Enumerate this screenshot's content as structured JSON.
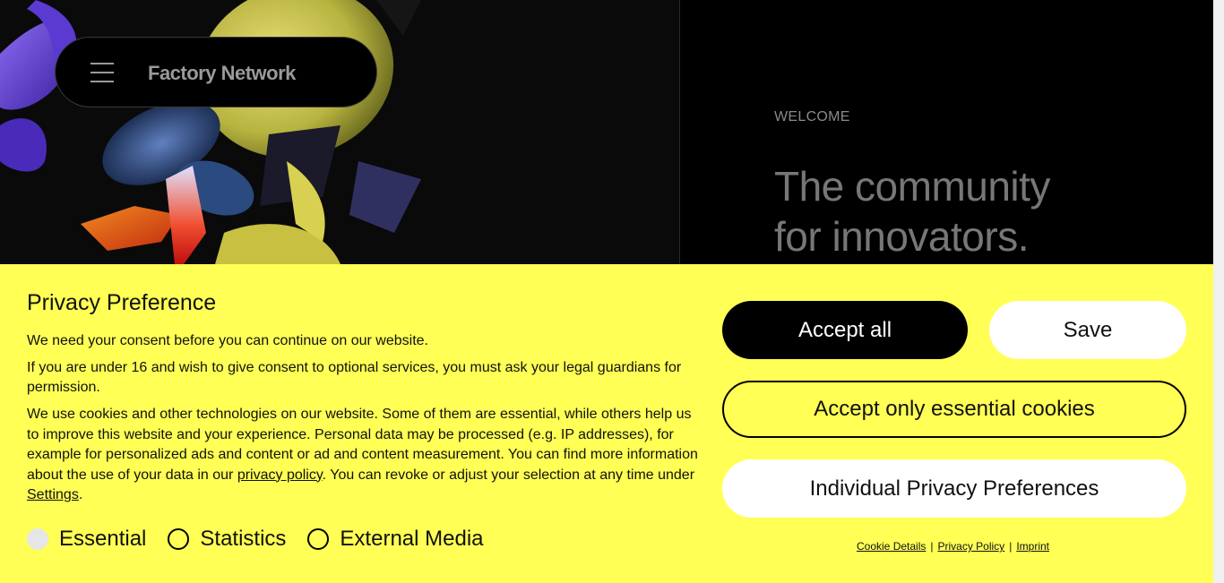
{
  "nav": {
    "brand": "Factory Network"
  },
  "hero": {
    "eyebrow": "WELCOME",
    "headline_line1": "The community",
    "headline_line2": "for innovators."
  },
  "consent": {
    "title": "Privacy Preference",
    "p1": "We need your consent before you can continue on our website.",
    "p2": "If you are under 16 and wish to give consent to optional services, you must ask your legal guardians for permission.",
    "p3_part1": "We use cookies and other technologies on our website. Some of them are essential, while others help us to improve this website and your experience. Personal data may be processed (e.g. IP addresses), for example for personalized ads and content or ad and content measurement. You can find more information about the use of your data in our ",
    "p3_link_privacy": "privacy policy",
    "p3_part2": ". You can revoke or adjust your selection at any time under ",
    "p3_link_settings": "Settings",
    "p3_part3": ".",
    "checkboxes": [
      {
        "label": "Essential",
        "checked": true,
        "disabled": true
      },
      {
        "label": "Statistics",
        "checked": false,
        "disabled": false
      },
      {
        "label": "External Media",
        "checked": false,
        "disabled": false
      }
    ],
    "buttons": {
      "accept_all": "Accept all",
      "save": "Save",
      "accept_essential": "Accept only essential cookies",
      "individual": "Individual Privacy Preferences"
    },
    "links": {
      "cookie_details": "Cookie Details",
      "privacy_policy": "Privacy Policy",
      "imprint": "Imprint",
      "separator": "|"
    }
  },
  "colors": {
    "banner_bg": "#ffff55",
    "primary_button_bg": "#000000",
    "secondary_button_bg": "#ffffff"
  }
}
